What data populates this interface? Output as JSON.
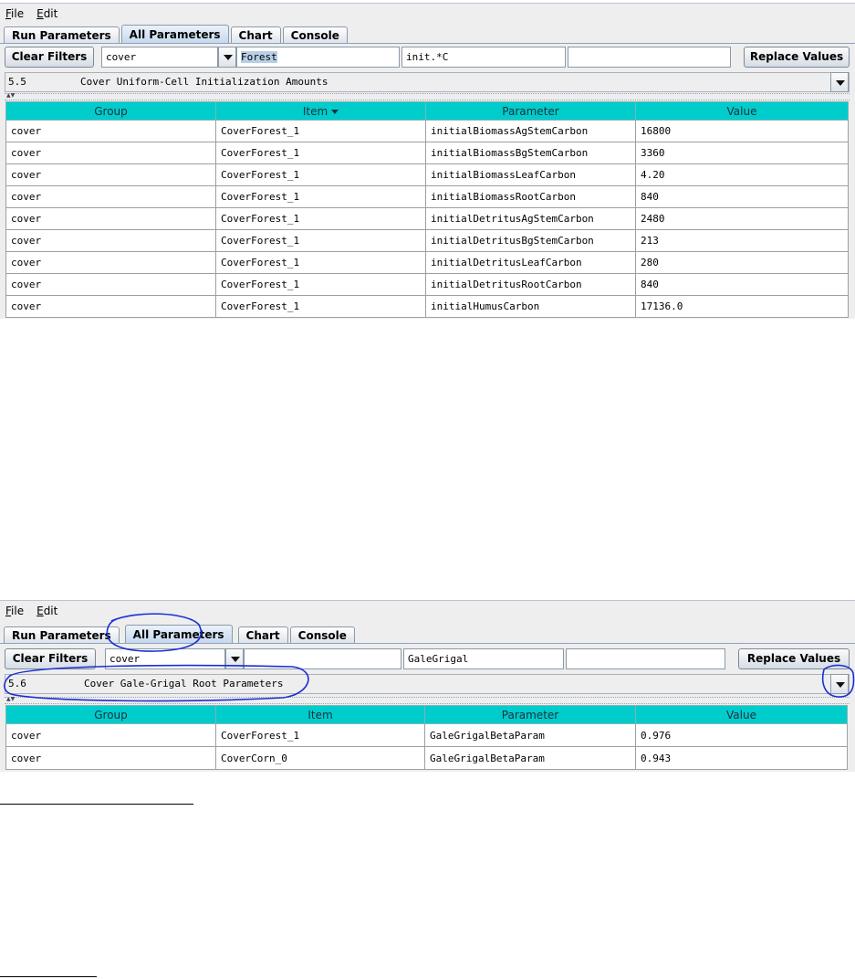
{
  "screen1": {
    "menu": [
      "File",
      "Edit"
    ],
    "tabs": [
      "Run Parameters",
      "All Parameters",
      "Chart",
      "Console"
    ],
    "active_tab": "All Parameters",
    "clear_filters_label": "Clear Filters",
    "group_filter": "cover",
    "item_filter": "Forest",
    "parameter_filter": "init.*C",
    "value_filter": "",
    "replace_values_label": "Replace Values",
    "section_number": "5.5",
    "section_title": "Cover Uniform-Cell Initialization Amounts",
    "columns": [
      "Group",
      "Item",
      "Parameter",
      "Value"
    ],
    "sorted_column": "Item",
    "rows": [
      [
        "cover",
        "CoverForest_1",
        "initialBiomassAgStemCarbon",
        "16800"
      ],
      [
        "cover",
        "CoverForest_1",
        "initialBiomassBgStemCarbon",
        "3360"
      ],
      [
        "cover",
        "CoverForest_1",
        "initialBiomassLeafCarbon",
        "4.20"
      ],
      [
        "cover",
        "CoverForest_1",
        "initialBiomassRootCarbon",
        "840"
      ],
      [
        "cover",
        "CoverForest_1",
        "initialDetritusAgStemCarbon",
        "2480"
      ],
      [
        "cover",
        "CoverForest_1",
        "initialDetritusBgStemCarbon",
        "213"
      ],
      [
        "cover",
        "CoverForest_1",
        "initialDetritusLeafCarbon",
        "280"
      ],
      [
        "cover",
        "CoverForest_1",
        "initialDetritusRootCarbon",
        "840"
      ],
      [
        "cover",
        "CoverForest_1",
        "initialHumusCarbon",
        "17136.0"
      ]
    ]
  },
  "screen2": {
    "menu": [
      "File",
      "Edit"
    ],
    "tabs": [
      "Run Parameters",
      "All Parameters",
      "Chart",
      "Console"
    ],
    "active_tab": "All Parameters",
    "clear_filters_label": "Clear Filters",
    "group_filter": "cover",
    "item_filter": "",
    "parameter_filter": "GaleGrigal",
    "value_filter": "",
    "replace_values_label": "Replace Values",
    "section_number": "5.6",
    "section_title": "Cover Gale-Grigal Root Parameters",
    "columns": [
      "Group",
      "Item",
      "Parameter",
      "Value"
    ],
    "rows": [
      [
        "cover",
        "CoverForest_1",
        "GaleGrigalBetaParam",
        "0.976"
      ],
      [
        "cover",
        "CoverCorn_0",
        "GaleGrigalBetaParam",
        "0.943"
      ]
    ]
  },
  "annotation_color": "#1a2fd6",
  "header_color": "#00cccc"
}
